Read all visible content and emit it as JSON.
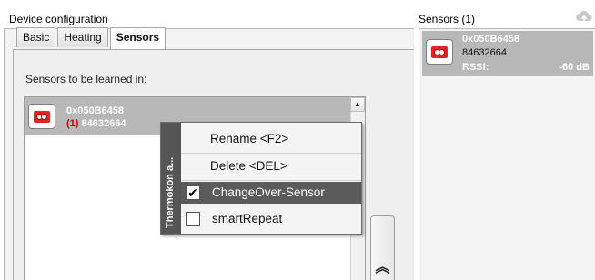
{
  "left_panel": {
    "title": "Device configuration",
    "tabs": [
      {
        "label": "Basic"
      },
      {
        "label": "Heating"
      },
      {
        "label": "Sensors"
      }
    ],
    "section_label": "Sensors to be learned in:",
    "sensor": {
      "id": "0x050B6458",
      "flag": "(1)",
      "serial": "84632664"
    },
    "scroll_up_glyph": "▲",
    "bottom_button_glyph": "︽"
  },
  "context_menu": {
    "side_label": "Thermokon a...",
    "items": [
      {
        "label": "Rename  <F2>"
      },
      {
        "label": "Delete  <DEL>"
      },
      {
        "label": "ChangeOver-Sensor",
        "checked": true,
        "highlighted": true
      },
      {
        "label": "smartRepeat",
        "checked": false
      }
    ],
    "check_glyph": "✔"
  },
  "right_panel": {
    "title": "Sensors (1)",
    "sensor": {
      "id": "0x050B6458",
      "serial": "84632664",
      "rssi_label": "RSSI:",
      "rssi_value": "-60 dB"
    }
  },
  "icons": {
    "sensor": "sensor-device-icon",
    "cloud": "cloud-upload-icon",
    "scroll_up": "chevron-up-icon",
    "move_up": "double-chevron-up-icon"
  },
  "colors": {
    "selection": "#b8b8b8",
    "menu_highlight": "#5b5b5b",
    "device_red": "#e32222",
    "flag_red": "#cc0000"
  }
}
